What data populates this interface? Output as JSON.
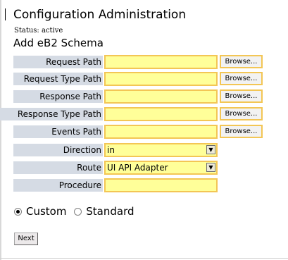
{
  "header": {
    "title": "Configuration Administration",
    "status": "Status: active",
    "section_title": "Add eB2 Schema"
  },
  "fields": [
    {
      "label": "Request Path",
      "value": "",
      "browse_label": "Browse..."
    },
    {
      "label": "Request Type Path",
      "value": "",
      "browse_label": "Browse..."
    },
    {
      "label": "Response Path",
      "value": "",
      "browse_label": "Browse..."
    },
    {
      "label": "Response Type Path",
      "value": "",
      "browse_label": "Browse..."
    },
    {
      "label": "Events Path",
      "value": "",
      "browse_label": "Browse..."
    }
  ],
  "direction": {
    "label": "Direction",
    "value": "in"
  },
  "route": {
    "label": "Route",
    "value": "UI API Adapter"
  },
  "procedure": {
    "label": "Procedure",
    "value": ""
  },
  "mode": {
    "options": [
      "Custom",
      "Standard"
    ],
    "selected": "Custom"
  },
  "actions": {
    "next_label": "Next"
  },
  "colors": {
    "input_background": "#ffff99",
    "input_border": "#f3c655",
    "label_background": "#d5dbe4"
  }
}
